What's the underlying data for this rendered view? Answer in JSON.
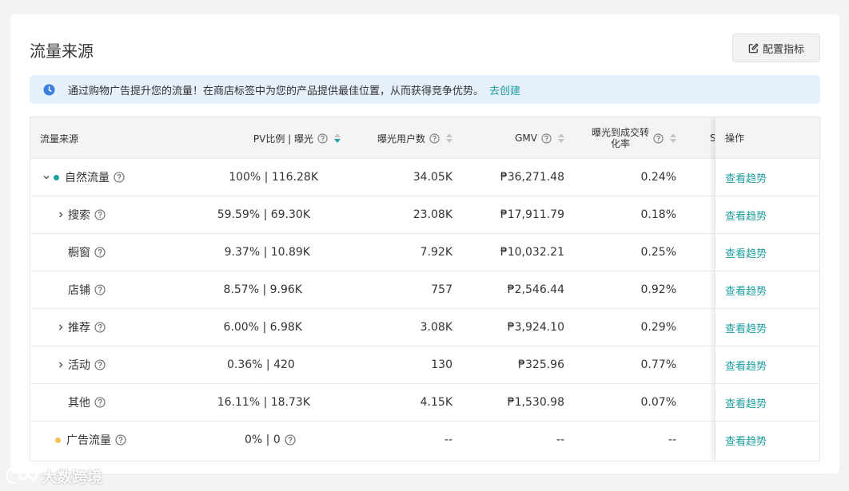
{
  "page": {
    "title": "流量来源",
    "config_button": "配置指标",
    "banner_text": "通过购物广告提升您的流量！在商店标签中为您的产品提供最佳位置，从而获得竞争优势。",
    "banner_link": "去创建"
  },
  "table": {
    "headers": {
      "source": "流量来源",
      "pv": "PV比例 | 曝光",
      "users": "曝光用户数",
      "gmv": "GMV",
      "conv_line1": "曝光到成交转",
      "conv_line2": "化率",
      "peek": "S",
      "action": "操作"
    },
    "rows": [
      {
        "name": "自然流量",
        "pv": "100% | 116.28K",
        "users": "34.05K",
        "gmv": "₱36,271.48",
        "conv": "0.24%",
        "action": "查看趋势"
      },
      {
        "name": "搜索",
        "pv": "59.59% | 69.30K",
        "users": "23.08K",
        "gmv": "₱17,911.79",
        "conv": "0.18%",
        "action": "查看趋势"
      },
      {
        "name": "橱窗",
        "pv": "9.37% | 10.89K",
        "users": "7.92K",
        "gmv": "₱10,032.21",
        "conv": "0.25%",
        "action": "查看趋势"
      },
      {
        "name": "店铺",
        "pv": "8.57% | 9.96K",
        "users": "757",
        "gmv": "₱2,546.44",
        "conv": "0.92%",
        "action": "查看趋势"
      },
      {
        "name": "推荐",
        "pv": "6.00% | 6.98K",
        "users": "3.08K",
        "gmv": "₱3,924.10",
        "conv": "0.29%",
        "action": "查看趋势"
      },
      {
        "name": "活动",
        "pv": "0.36% | 420",
        "users": "130",
        "gmv": "₱325.96",
        "conv": "0.77%",
        "action": "查看趋势"
      },
      {
        "name": "其他",
        "pv": "16.11% | 18.73K",
        "users": "4.15K",
        "gmv": "₱1,530.98",
        "conv": "0.07%",
        "action": "查看趋势"
      },
      {
        "name": "广告流量",
        "pv": "0% | 0",
        "users": "--",
        "gmv": "--",
        "conv": "--",
        "action": "查看趋势"
      }
    ]
  },
  "colors": {
    "accent": "#1e9e9e",
    "organic_dot": "#1e9e9e",
    "ads_dot": "#f2c14e",
    "banner_bg": "#e6f0fc",
    "info_icon": "#3d7fe0"
  },
  "watermark": "大数跨境"
}
